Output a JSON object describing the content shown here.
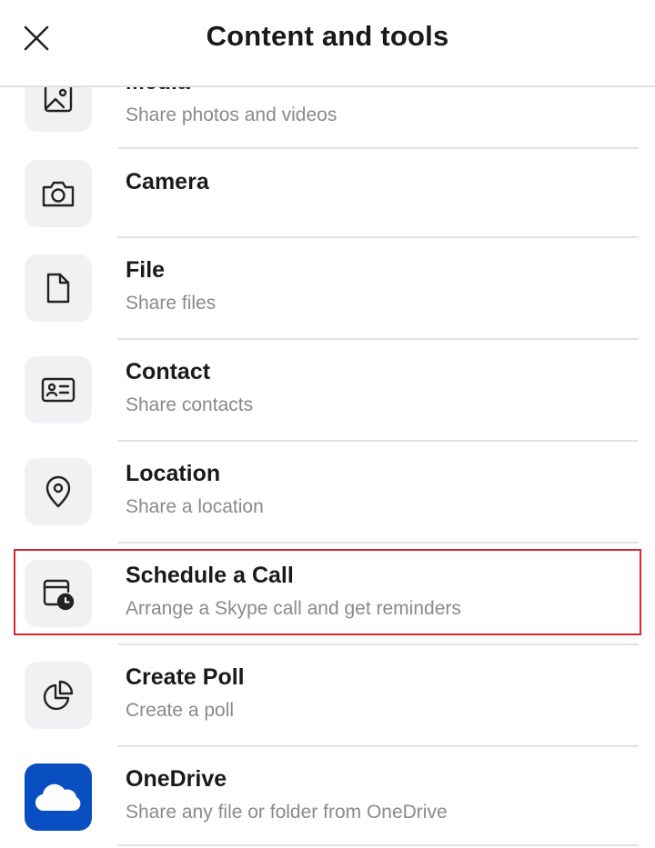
{
  "header": {
    "title": "Content and tools",
    "close_icon": "close-icon"
  },
  "items": [
    {
      "label": "Media",
      "sub": "Share photos and videos",
      "icon": "image-icon"
    },
    {
      "label": "Camera",
      "sub": "",
      "icon": "camera-icon"
    },
    {
      "label": "File",
      "sub": "Share files",
      "icon": "file-icon"
    },
    {
      "label": "Contact",
      "sub": "Share contacts",
      "icon": "contact-card-icon"
    },
    {
      "label": "Location",
      "sub": "Share a location",
      "icon": "location-pin-icon"
    },
    {
      "label": "Schedule a Call",
      "sub": "Arrange a Skype call and get reminders",
      "icon": "calendar-clock-icon"
    },
    {
      "label": "Create Poll",
      "sub": "Create a poll",
      "icon": "pie-chart-icon"
    },
    {
      "label": "OneDrive",
      "sub": "Share any file or folder from OneDrive",
      "icon": "onedrive-cloud-icon"
    }
  ],
  "colors": {
    "highlight": "#d9252c",
    "onedrive": "#0a4fc1",
    "icon_bg": "#f1f1f3",
    "subtext": "#8a8a8a"
  }
}
